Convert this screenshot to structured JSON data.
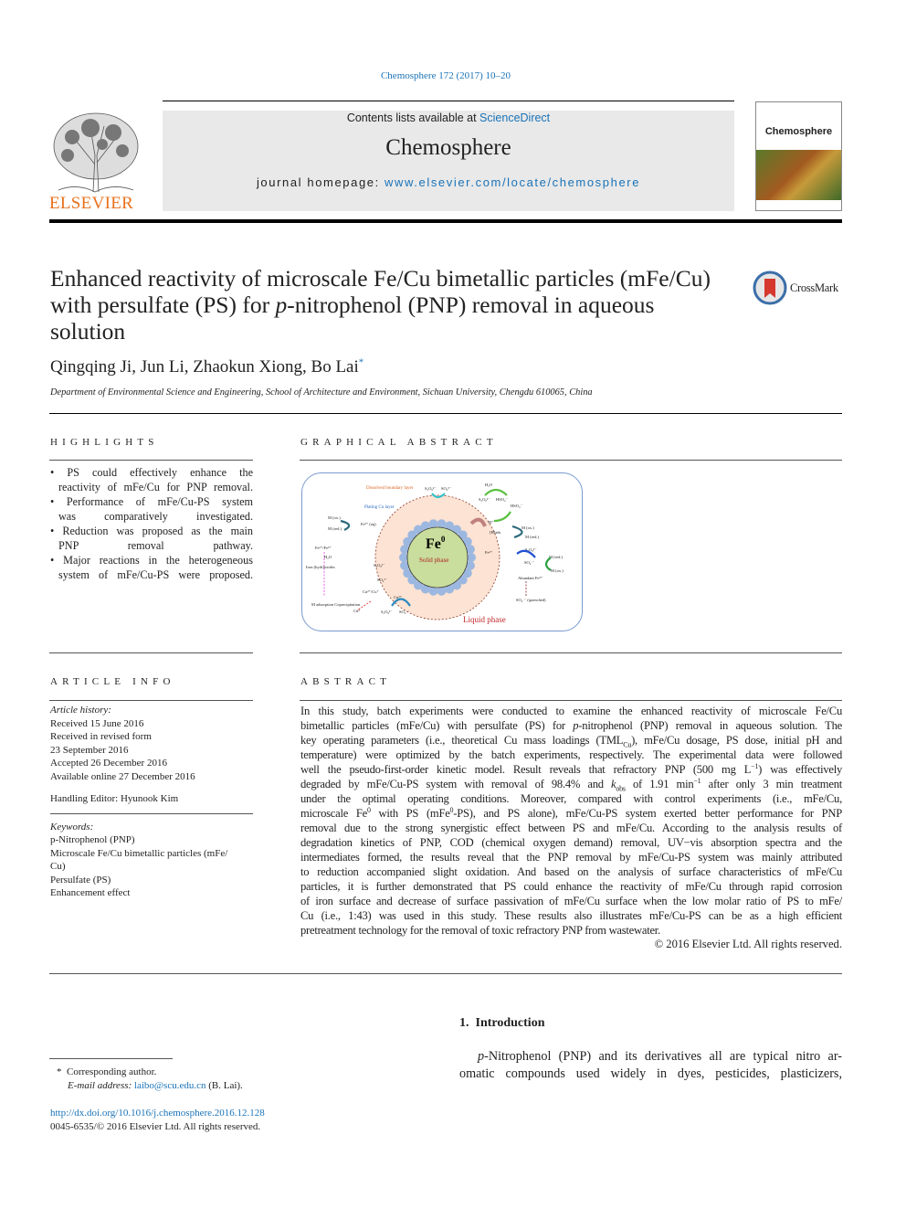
{
  "citation": "Chemosphere 172 (2017) 10–20",
  "header": {
    "publisher": "ELSEVIER",
    "contents_prefix": "Contents lists available at ",
    "contents_link": "ScienceDirect",
    "journal": "Chemosphere",
    "homepage_prefix": "journal homepage: ",
    "homepage_link": "www.elsevier.com/locate/chemosphere",
    "cover_title": "Chemosphere"
  },
  "article": {
    "title_lines": [
      "Enhanced reactivity of microscale Fe/Cu bimetallic particles (mFe/Cu)",
      "with persulfate (PS) for ",
      "p",
      "-nitrophenol (PNP) removal in aqueous",
      "solution"
    ],
    "crossmark": "CrossMark",
    "authors": "Qingqing Ji, Jun Li, Zhaokun Xiong, Bo Lai",
    "author_mark": "*",
    "affiliation": "Department of Environmental Science and Engineering, School of Architecture and Environment, Sichuan University, Chengdu 610065, China"
  },
  "highlights": {
    "heading": "HIGHLIGHTS",
    "lines": [
      [
        "• PS could effectively enhance the",
        true
      ],
      [
        "reactivity of mFe/Cu for PNP removal.",
        false
      ],
      [
        "• Performance of mFe/Cu-PS system",
        true
      ],
      [
        "was comparatively investigated.",
        false
      ],
      [
        "• Reduction was proposed as the main",
        true
      ],
      [
        "PNP removal pathway.",
        false
      ],
      [
        "• Major reactions in the heterogeneous",
        true
      ],
      [
        "system of mFe/Cu-PS were proposed.",
        false
      ]
    ]
  },
  "graphical_abstract": {
    "heading": "GRAPHICAL ABSTRACT",
    "labels": {
      "boundary": "Dissolved boundary layer",
      "plating": "Plating Cu layer",
      "core": "Fe",
      "core_sup": "0",
      "solid": "Solid phase",
      "liquid": "Liquid phase",
      "m_ox": "M (ox.)",
      "m_red": "M (red.)",
      "fe2aq": "Fe²⁺ (aq)",
      "fe_ions": "Fe²⁺/Fe³⁺",
      "h2o": "H₂O",
      "iron_hydroxides": "Iron (hydr)oxides",
      "adsorption": "M adsorption Coprecipitation",
      "s2o8": "S₂O₈²⁻",
      "so4": "SO₄²⁻",
      "so4rad": "SO₄·⁻",
      "hso4": "HSO₄⁻",
      "h_plus": "H⁺",
      "h_ads": "[H]ads",
      "cu": "Cu",
      "cu2": "Cu²⁺",
      "cu_ions": "Cu²⁺/Cu⁺",
      "cu0": "Cu⁰",
      "e": "e⁻",
      "abundant": "Abundant Fe²⁺",
      "quenched": "SO₄·⁻ (quenched)",
      "fe3": "Fe³⁺"
    },
    "colors": {
      "core": "#c9dd9c",
      "layer": "#fde3d3",
      "particles": "#9cb8e0",
      "border": "#7a9ad0",
      "liquid_text": "#c0282c"
    }
  },
  "article_info": {
    "heading": "ARTICLE INFO",
    "history_label": "Article history:",
    "history": [
      "Received 15 June 2016",
      "Received in revised form",
      "23 September 2016",
      "Accepted 26 December 2016",
      "Available online 27 December 2016"
    ],
    "editor": "Handling Editor: Hyunook Kim",
    "keywords_label": "Keywords:",
    "keywords": [
      "p-Nitrophenol (PNP)",
      "Microscale Fe/Cu bimetallic particles (mFe/",
      "Cu)",
      "Persulfate (PS)",
      "Enhancement effect"
    ]
  },
  "abstract": {
    "heading": "ABSTRACT",
    "lines": [
      [
        [
          "In this study, batch experiments were conducted to examine the enhanced reactivity of microscale Fe/Cu"
        ]
      ],
      [
        [
          "bimetallic particles (mFe/Cu) with persulfate (PS) for "
        ],
        [
          "p",
          "i"
        ],
        [
          "-nitrophenol (PNP) removal in aqueous solution. The"
        ]
      ],
      [
        [
          "key operating parameters (i.e., theoretical Cu mass loadings (TML"
        ],
        [
          "Cu",
          "sub"
        ],
        [
          "), mFe/Cu dosage, PS dose, initial pH and"
        ]
      ],
      [
        [
          "temperature) were optimized by the batch experiments, respectively. The experimental data were followed"
        ]
      ],
      [
        [
          "well the pseudo-first-order kinetic model. Result reveals that refractory PNP (500 mg L"
        ],
        [
          "−1",
          "sup"
        ],
        [
          ") was effectively"
        ]
      ],
      [
        [
          "degraded by mFe/Cu-PS system with removal of 98.4% and "
        ],
        [
          "k",
          "i"
        ],
        [
          "obs",
          "sub"
        ],
        [
          " of 1.91 min"
        ],
        [
          "−1",
          "sup"
        ],
        [
          " after only 3 min treatment"
        ]
      ],
      [
        [
          "under the optimal operating conditions. Moreover, compared with control experiments (i.e., mFe/Cu,"
        ]
      ],
      [
        [
          "microscale Fe"
        ],
        [
          "0",
          "sup"
        ],
        [
          " with PS (mFe"
        ],
        [
          "0",
          "sup"
        ],
        [
          "-PS), and PS alone), mFe/Cu-PS system exerted better performance for PNP"
        ]
      ],
      [
        [
          "removal due to the strong synergistic effect between PS and mFe/Cu. According to the analysis results of"
        ]
      ],
      [
        [
          "degradation kinetics of PNP, COD (chemical oxygen demand) removal, UV−vis absorption spectra and the"
        ]
      ],
      [
        [
          "intermediates formed, the results reveal that the PNP removal by mFe/Cu-PS system was mainly attributed"
        ]
      ],
      [
        [
          "to reduction accompanied slight oxidation. And based on the analysis of surface characteristics of mFe/Cu"
        ]
      ],
      [
        [
          "particles, it is further demonstrated that PS could enhance the reactivity of mFe/Cu through rapid corrosion"
        ]
      ],
      [
        [
          "of iron surface and decrease of surface passivation of mFe/Cu surface when the low molar ratio of PS to mFe/"
        ]
      ],
      [
        [
          "Cu (i.e., 1:43) was used in this study. These results also illustrates mFe/Cu-PS can be as a high efficient"
        ]
      ],
      [
        [
          "pretreatment technology for the removal of toxic refractory PNP from wastewater.",
          "last"
        ]
      ]
    ],
    "copyright": "© 2016 Elsevier Ltd. All rights reserved."
  },
  "intro": {
    "heading_num": "1.",
    "heading": "Introduction",
    "line1_italic": "p",
    "line1": "-Nitrophenol (PNP) and its derivatives all are typical nitro ar-",
    "line2": "omatic compounds used widely in dyes, pesticides, plasticizers,"
  },
  "footnote": {
    "mark": "*",
    "corresponding": "Corresponding author.",
    "email_label": "E-mail address: ",
    "email": "laibo@scu.edu.cn",
    "email_suffix": " (B. Lai).",
    "doi": "http://dx.doi.org/10.1016/j.chemosphere.2016.12.128",
    "issn": "0045-6535/© 2016 Elsevier Ltd. All rights reserved."
  }
}
